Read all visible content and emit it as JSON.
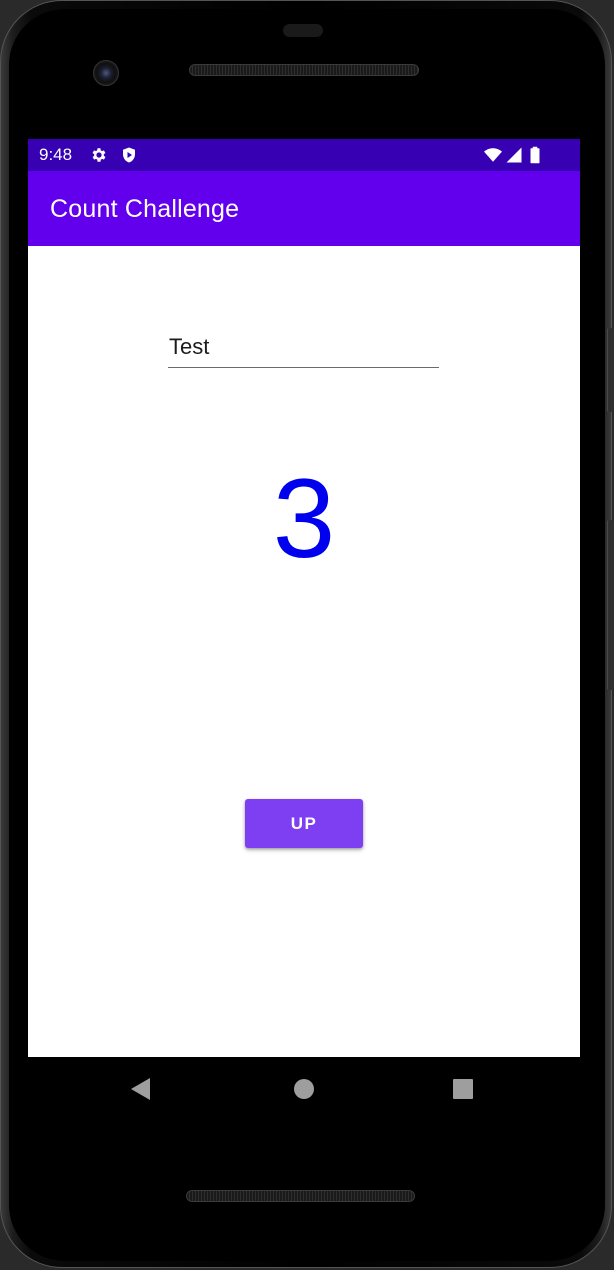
{
  "status_bar": {
    "time": "9:48",
    "background_color": "#3700b3",
    "left_icons": [
      "settings-gear-icon",
      "shield-play-icon"
    ],
    "right_icons": [
      "wifi-icon",
      "cellular-signal-icon",
      "battery-icon"
    ]
  },
  "app_bar": {
    "title": "Count Challenge",
    "background_color": "#6200ee"
  },
  "main": {
    "text_field": {
      "value": "Test"
    },
    "count": "3",
    "count_color": "#0000ee",
    "up_button": {
      "label": "UP",
      "background_color": "#7e3ff2"
    }
  },
  "nav_bar": {
    "icons": [
      "back-icon",
      "home-icon",
      "recents-icon"
    ]
  }
}
